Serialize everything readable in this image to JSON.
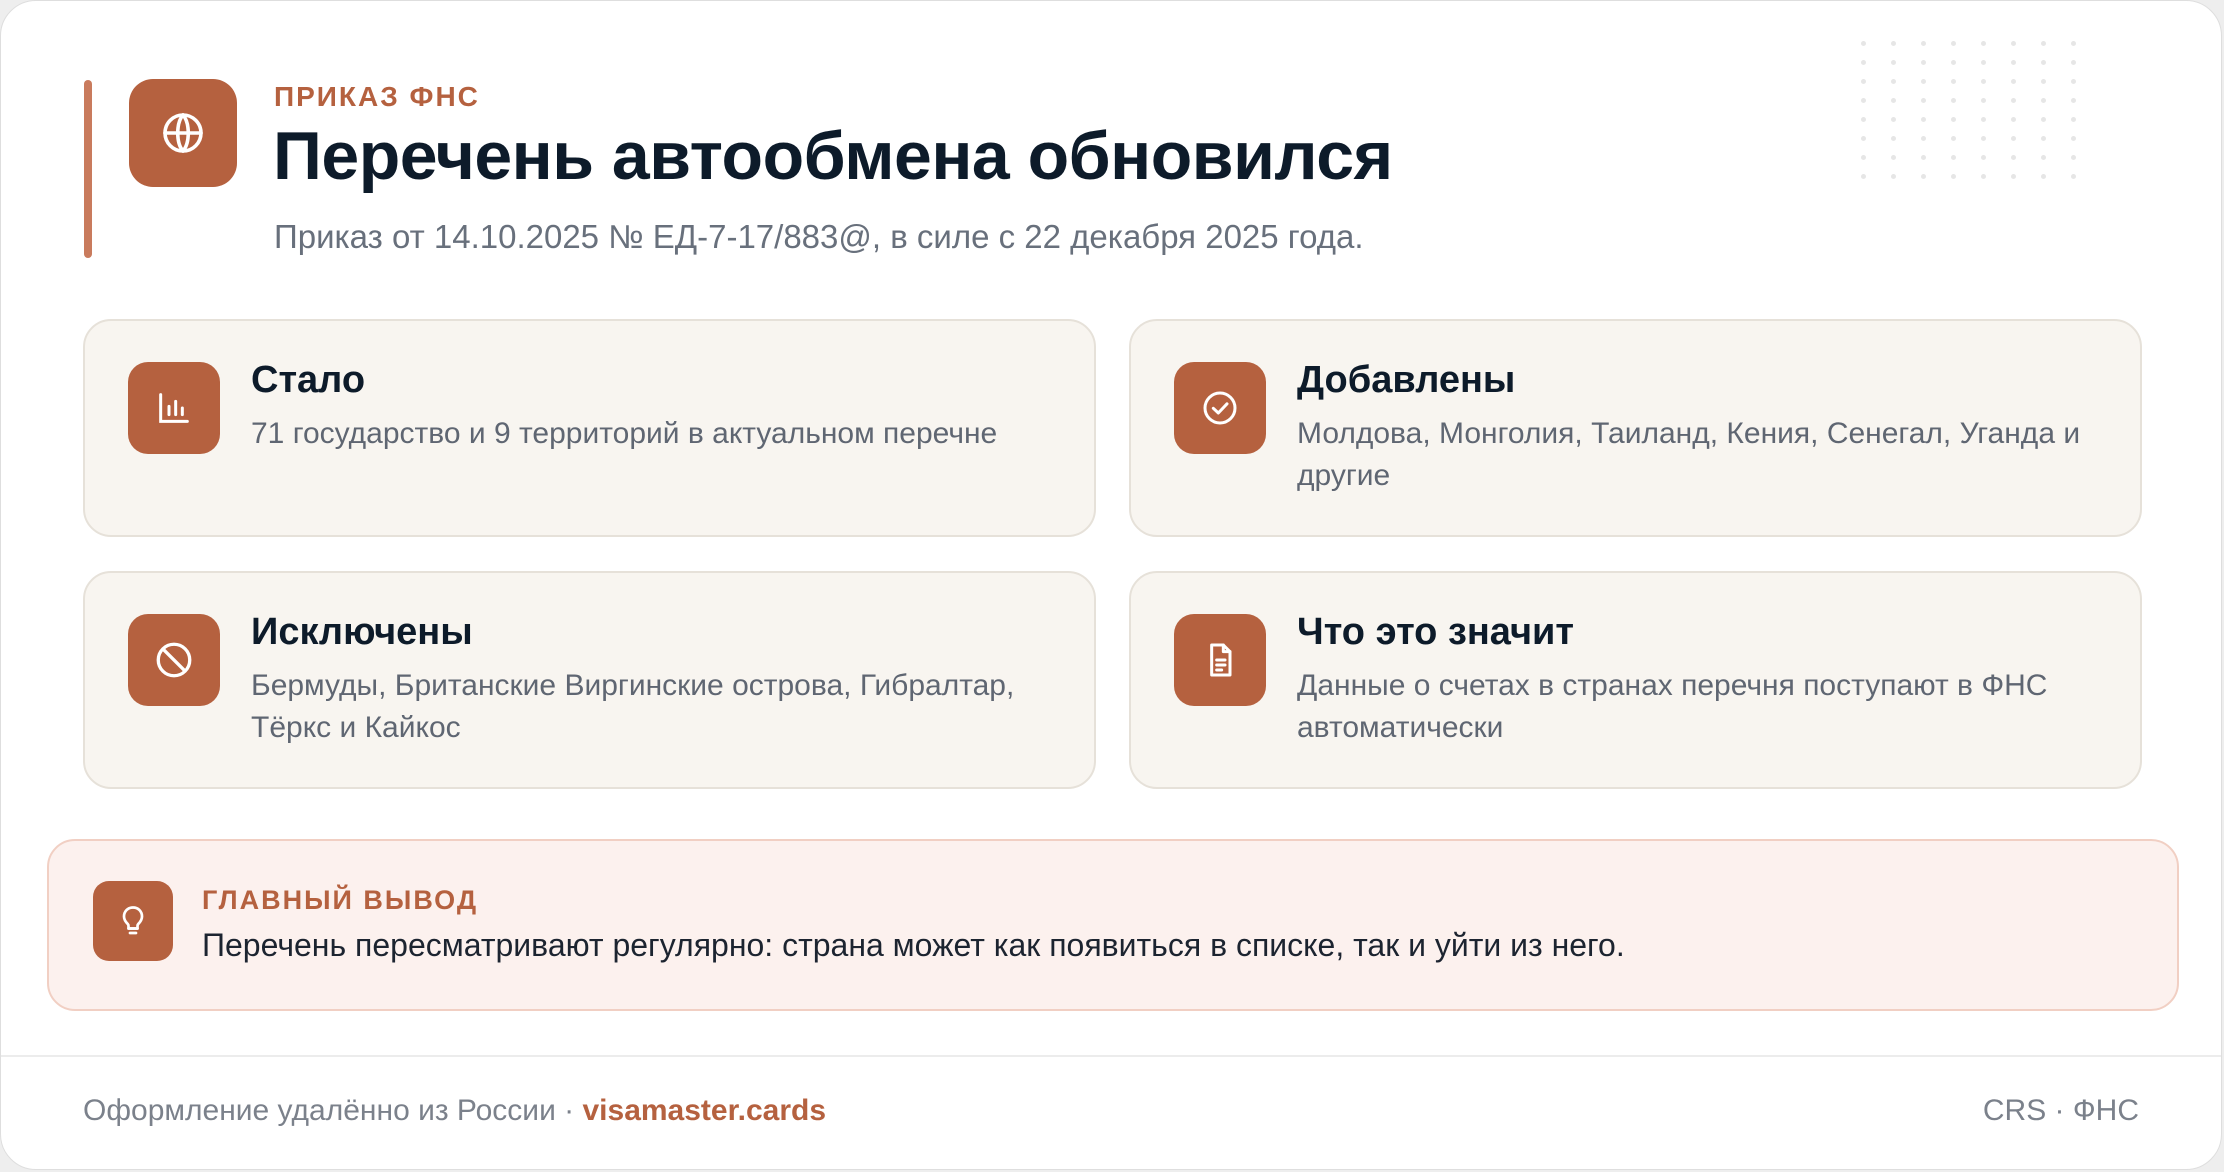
{
  "header": {
    "eyebrow": "ПРИКАЗ ФНС",
    "title": "Перечень автообмена обновился",
    "subtitle": "Приказ от 14.10.2025 № ЕД-7-17/883@, в силе с 22 декабря 2025 года.",
    "icon": "globe-icon"
  },
  "tiles": [
    {
      "icon": "bar-chart-icon",
      "title": "Стало",
      "text": "71 государство и 9 территорий в актуальном перечне"
    },
    {
      "icon": "check-circle-icon",
      "title": "Добавлены",
      "text": "Молдова, Монголия, Таиланд, Кения, Сенегал, Уганда и другие"
    },
    {
      "icon": "prohibited-icon",
      "title": "Исключены",
      "text": "Бермуды, Британские Виргинские острова, Гибралтар, Тёркс и Кайкос"
    },
    {
      "icon": "document-icon",
      "title": "Что это значит",
      "text": "Данные о счетах в странах перечня поступают в ФНС автоматически"
    }
  ],
  "callout": {
    "icon": "lightbulb-icon",
    "label": "ГЛАВНЫЙ ВЫВОД",
    "text": "Перечень пересматривают регулярно: страна может как появиться в списке, так и уйти из него."
  },
  "footer": {
    "left_text": "Оформление удалённо из России · ",
    "brand": "visamaster.cards",
    "right_text": "CRS · ФНС"
  },
  "colors": {
    "accent": "#b5613f",
    "accent_bar": "#c97b5d",
    "title": "#0d1b2a",
    "tile_bg": "#f8f5f0",
    "callout_bg": "#fcf1ee"
  }
}
